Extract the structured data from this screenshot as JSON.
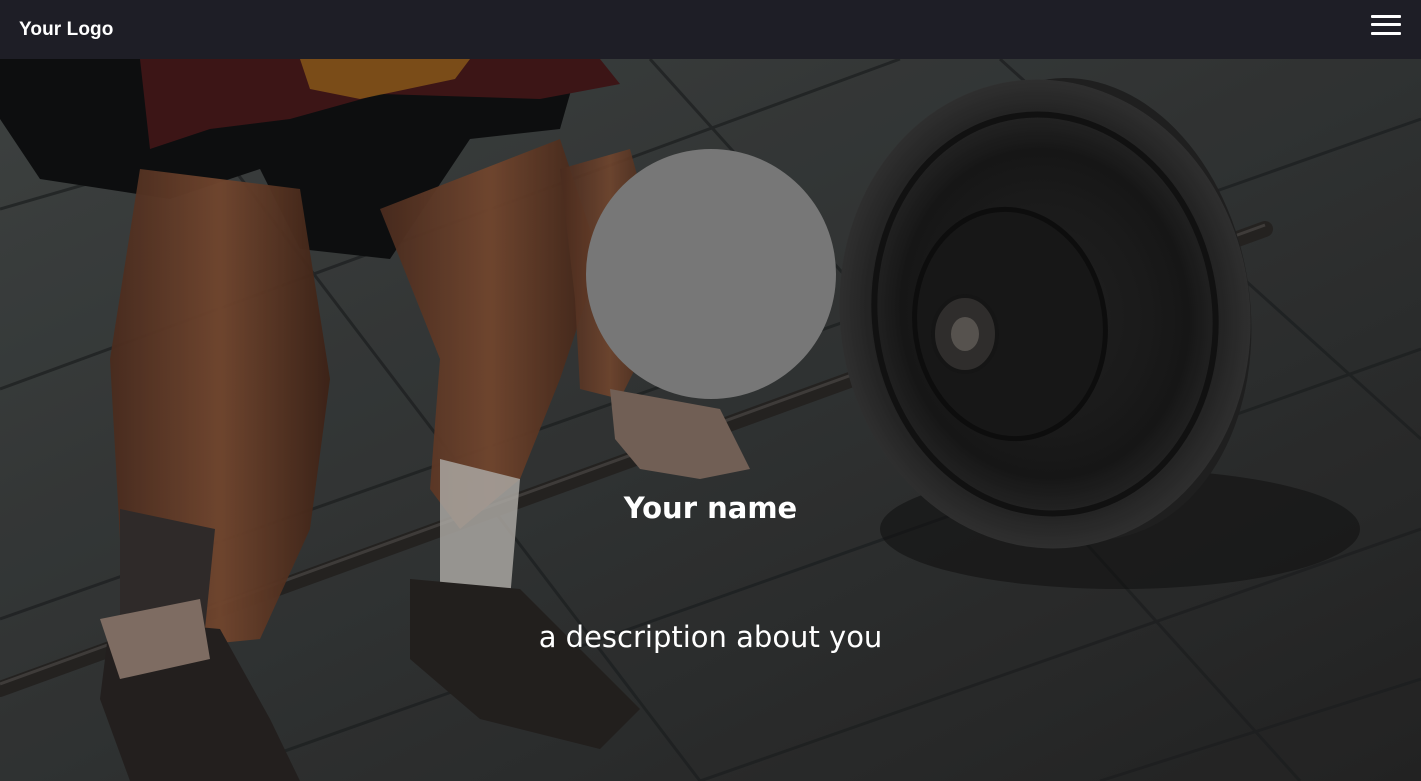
{
  "navbar": {
    "logo_text": "Your Logo",
    "menu_icon": "hamburger-menu-icon"
  },
  "hero": {
    "name": "Your name",
    "description": "a description about you",
    "avatar_color": "#777777"
  },
  "colors": {
    "navbar_bg": "#1e1e26",
    "text": "#ffffff"
  }
}
